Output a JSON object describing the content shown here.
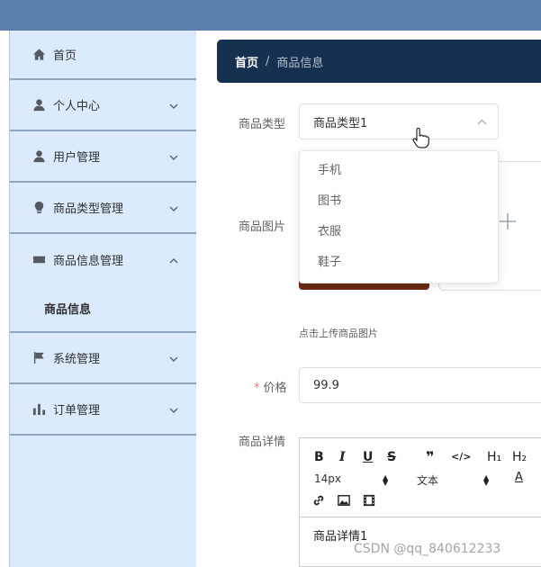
{
  "sidebar": {
    "items": [
      {
        "label": "首页",
        "icon": "home-icon"
      },
      {
        "label": "个人中心",
        "icon": "user-icon"
      },
      {
        "label": "用户管理",
        "icon": "users-icon"
      },
      {
        "label": "商品类型管理",
        "icon": "bulb-icon"
      },
      {
        "label": "商品信息管理",
        "icon": "ticket-icon"
      },
      {
        "label": "商品信息"
      },
      {
        "label": "系统管理",
        "icon": "flag-icon"
      },
      {
        "label": "订单管理",
        "icon": "bar-chart-icon"
      }
    ]
  },
  "breadcrumb": {
    "home": "首页",
    "separator": "/",
    "current": "商品信息"
  },
  "form": {
    "type_label": "商品类型",
    "type_value": "商品类型1",
    "type_options": [
      "手机",
      "图书",
      "衣服",
      "鞋子"
    ],
    "image_label": "商品图片",
    "upload_tip": "点击上传商品图片",
    "price_required_mark": "*",
    "price_label": "价格",
    "price_value": "99.9",
    "detail_label": "商品详情",
    "detail_value": "商品详情1"
  },
  "editor": {
    "bold": "B",
    "italic": "I",
    "underline": "U",
    "strike": "S",
    "quote": "❞",
    "code": "</>",
    "h1": "H₁",
    "h2": "H₂",
    "font_size": "14px",
    "text_type": "文本",
    "font_color": "A"
  },
  "watermark": "CSDN @qq_840612233",
  "colors": {
    "topbar": "#5b7fae",
    "sidebar": "#dbeafc",
    "breadcrumb": "#16304f",
    "required": "#f56c6c"
  }
}
